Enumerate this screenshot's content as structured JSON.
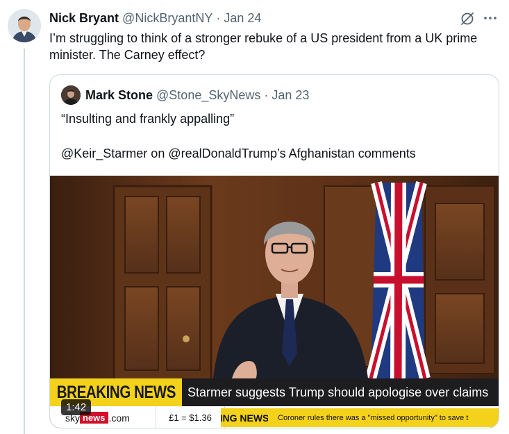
{
  "tweet": {
    "author_name": "Nick Bryant",
    "author_handle": "@NickBryantNY",
    "separator": "·",
    "date": "Jan 24",
    "text": "I’m struggling to think of a stronger rebuke of a US president from a UK prime minister. The Carney effect?",
    "icons": [
      "grok-icon",
      "more-icon"
    ]
  },
  "quote": {
    "author_name": "Mark Stone",
    "author_handle": "@Stone_SkyNews",
    "separator": "·",
    "date": "Jan 23",
    "text_line1": "“Insulting and frankly appalling”",
    "text_line2": "@Keir_Starmer on @realDonaldTrump’s Afghanistan comments",
    "video": {
      "duration": "1:42",
      "banner_label": "BREAKING NEWS",
      "banner_headline": "Starmer suggests Trump should apologise over claims",
      "ticker_site_prefix": "sky",
      "ticker_site_red": "news",
      "ticker_site_suffix": ".com",
      "ticker_fx": "£1 = $1.36",
      "ticker_tag": "ING NEWS",
      "ticker_text": "Coroner rules there was a \"missed opportunity\" to save t"
    }
  },
  "colors": {
    "text_primary": "#0f1419",
    "text_secondary": "#536471",
    "border": "#cfd9de",
    "sky_yellow": "#f4d21b",
    "sky_red": "#d2102a"
  }
}
